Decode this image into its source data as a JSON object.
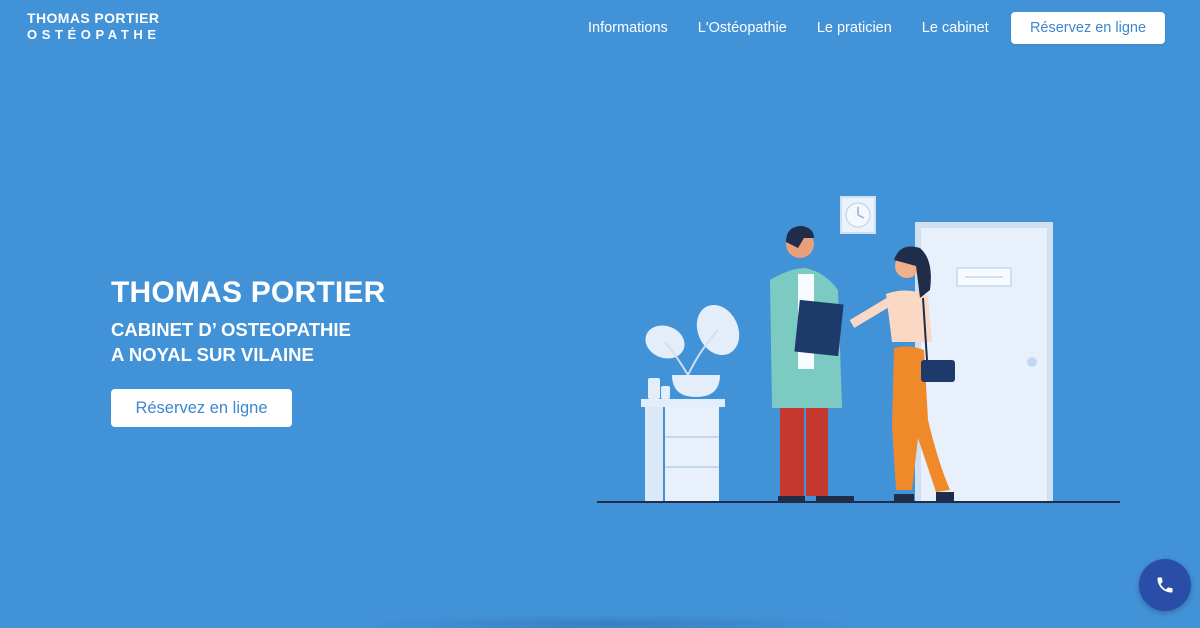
{
  "brand": {
    "line1": "THOMAS PORTIER",
    "line2": "OSTÉOPATHE"
  },
  "nav": {
    "items": [
      "Informations",
      "L'Ostéopathie",
      "Le praticien",
      "Le cabinet"
    ],
    "cta_label": "Réservez en ligne"
  },
  "hero": {
    "title": "THOMAS PORTIER",
    "subtitle_line1": "CABINET D’ OSTEOPATHIE",
    "subtitle_line2": "A NOYAL SUR VILAINE",
    "cta_label": "Réservez en ligne"
  },
  "colors": {
    "background": "#4292d8",
    "accent": "#3d86d0",
    "phone_button": "#2a4ea8"
  },
  "icons": {
    "phone": "phone-icon"
  }
}
